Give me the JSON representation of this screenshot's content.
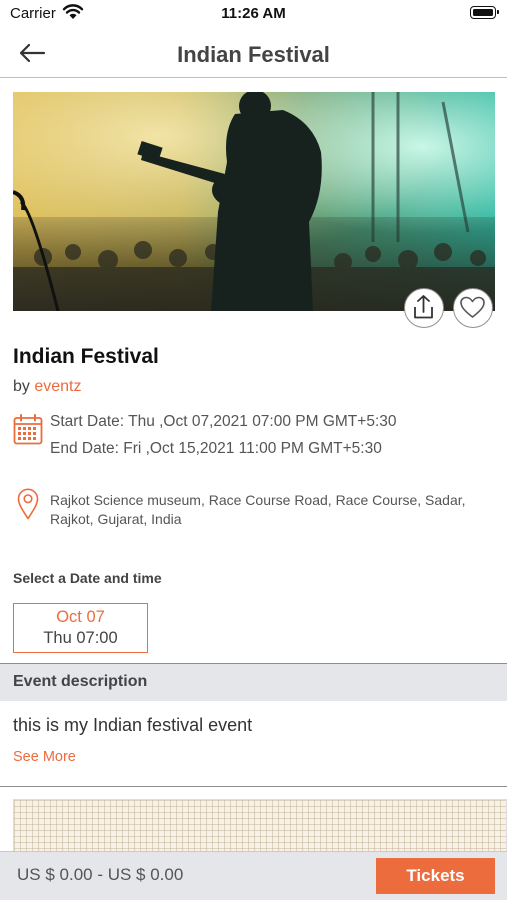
{
  "status_bar": {
    "carrier": "Carrier",
    "time": "11:26 AM"
  },
  "nav": {
    "title": "Indian Festival",
    "back_icon": "arrow-left-icon"
  },
  "hero": {
    "image": "concert-guitarist-photo",
    "share_icon": "share-upload-icon",
    "favorite_icon": "heart-icon"
  },
  "event": {
    "title": "Indian Festival",
    "by_label": "by",
    "organizer": "eventz",
    "start_date": "Start Date: Thu ,Oct 07,2021 07:00 PM GMT+5:30",
    "end_date": "End Date: Fri ,Oct 15,2021 11:00 PM GMT+5:30",
    "venue": "Rajkot Science museum, Race Course Road, Race Course, Sadar, Rajkot, Gujarat, India"
  },
  "schedule": {
    "label": "Select a Date and time",
    "slots": [
      {
        "date": "Oct 07",
        "time": "Thu 07:00"
      }
    ]
  },
  "description": {
    "header": "Event description",
    "text": "this is my Indian festival event",
    "see_more": "See More"
  },
  "footer": {
    "price_range": "US $ 0.00 -  US $ 0.00",
    "tickets_label": "Tickets"
  },
  "colors": {
    "accent": "#ec6c3e",
    "header_bg": "#e4e6e9",
    "divider": "#bdbdbd"
  }
}
